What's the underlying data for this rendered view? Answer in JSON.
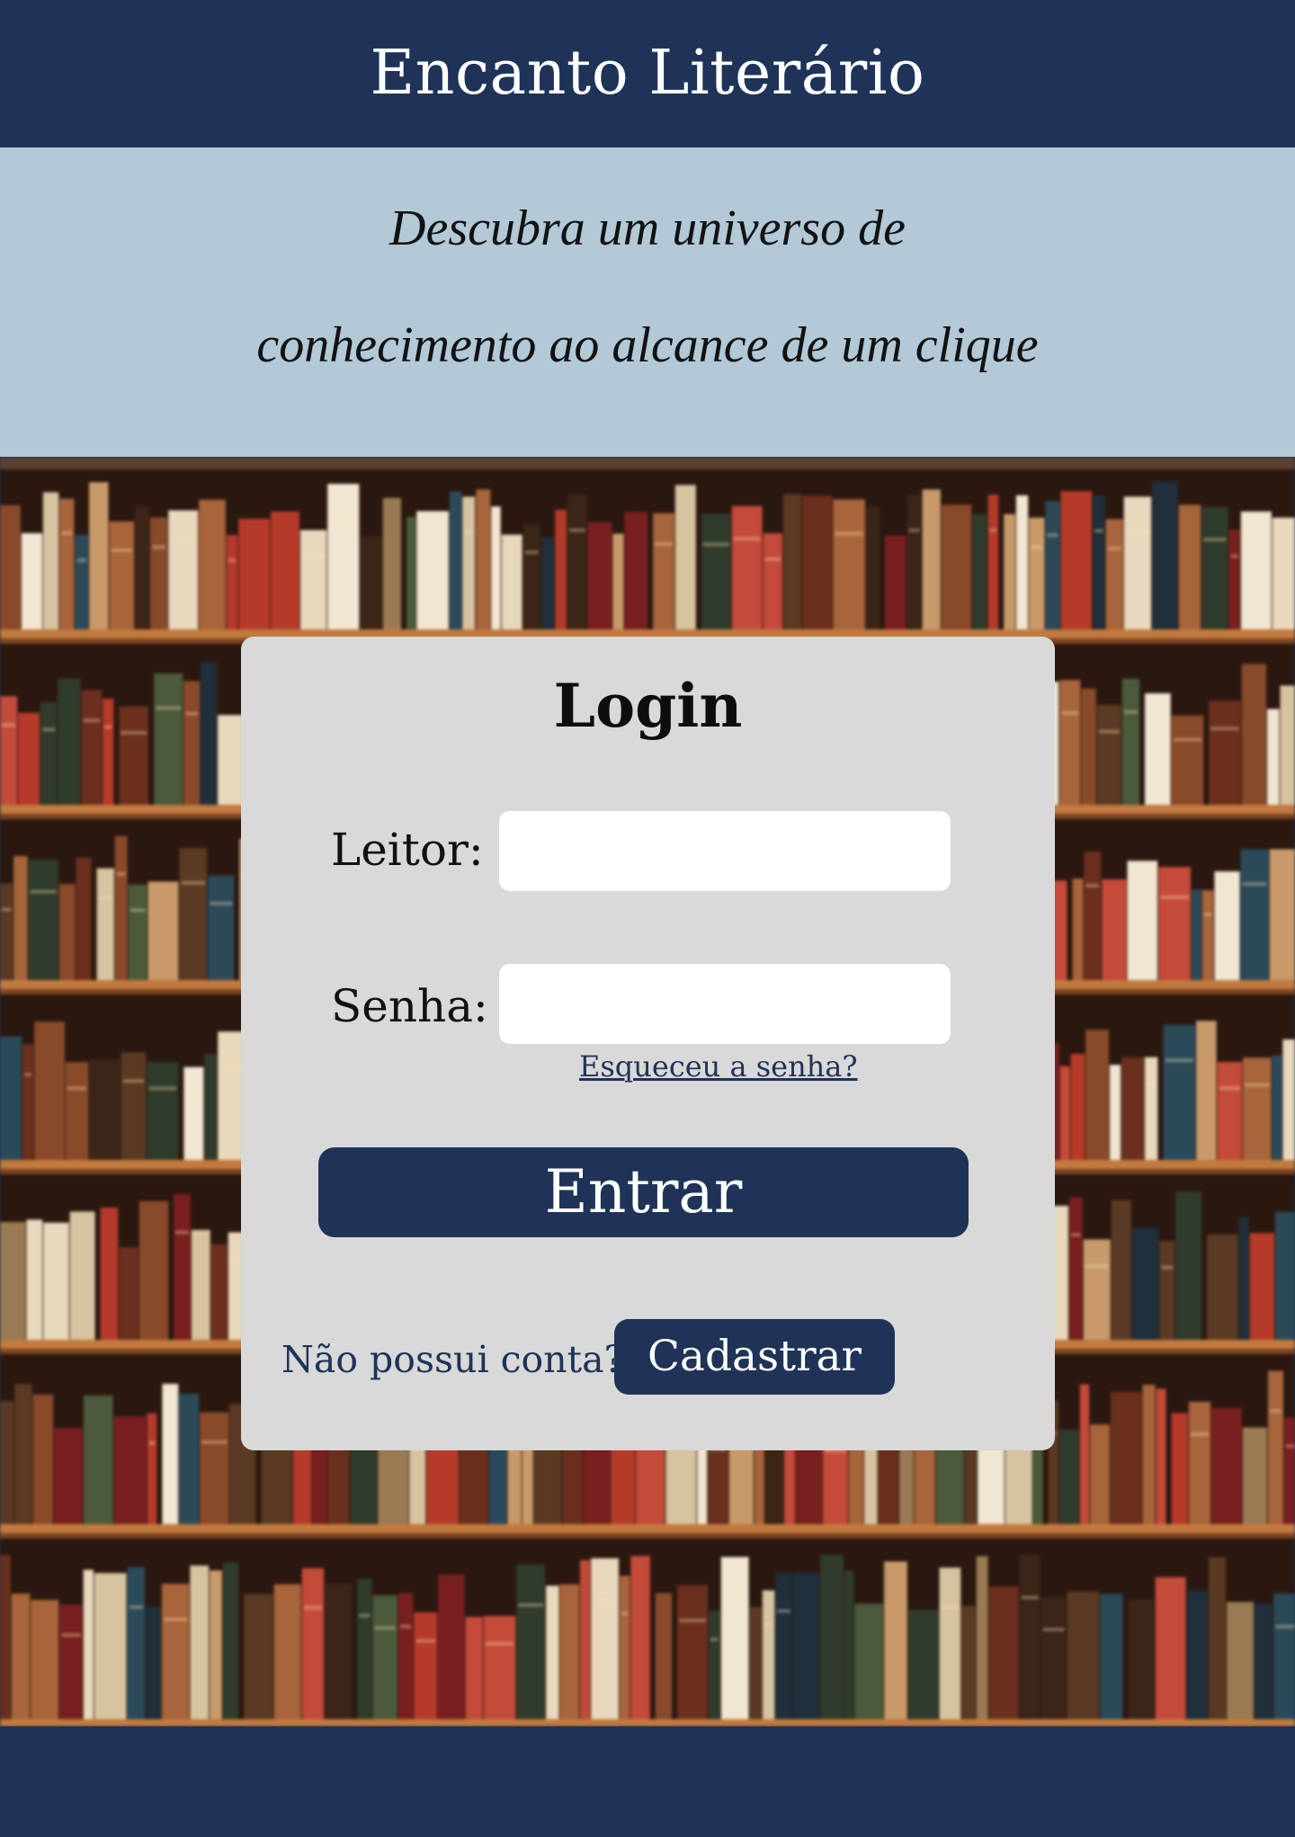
{
  "header": {
    "title": "Encanto Literário"
  },
  "tagline": {
    "line1": "Descubra um universo de",
    "line2": "conhecimento ao alcance de um clique"
  },
  "login": {
    "title": "Login",
    "reader_label": "Leitor:",
    "reader_value": "",
    "password_label": "Senha:",
    "password_value": "",
    "forgot_password": "Esqueceu a senha?",
    "submit_label": "Entrar",
    "no_account_text": "Não possui conta?",
    "register_label": "Cadastrar"
  },
  "colors": {
    "primary": "#1e3357",
    "tagline_bg": "#b3c9d8",
    "card_bg": "#d9d9d9"
  },
  "background_image": "bookshelf"
}
